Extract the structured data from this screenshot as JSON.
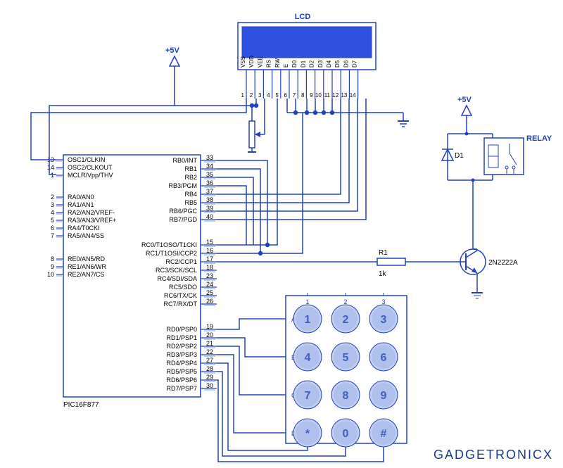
{
  "title": "LCD",
  "power_label": "+5V",
  "relay_label": "RELAY",
  "diode": "D1",
  "resistor": {
    "name": "R1",
    "value": "1k"
  },
  "transistor": "2N2222A",
  "mcu_name": "PIC16F877",
  "brand": "GADGETRONICX",
  "mcu_pins_left": [
    {
      "num": "13",
      "name": "OSC1/CLKIN"
    },
    {
      "num": "14",
      "name": "OSC2/CLKOUT"
    },
    {
      "num": "1",
      "name": "MCLR/Vpp/THV"
    },
    {
      "num": "2",
      "name": "RA0/AN0"
    },
    {
      "num": "3",
      "name": "RA1/AN1"
    },
    {
      "num": "4",
      "name": "RA2/AN2/VREF-"
    },
    {
      "num": "5",
      "name": "RA3/AN3/VREF+"
    },
    {
      "num": "6",
      "name": "RA4/T0CKI"
    },
    {
      "num": "7",
      "name": "RA5/AN4/SS"
    },
    {
      "num": "8",
      "name": "RE0/AN5/RD"
    },
    {
      "num": "9",
      "name": "RE1/AN6/WR"
    },
    {
      "num": "10",
      "name": "RE2/AN7/CS"
    }
  ],
  "mcu_pins_right_top": [
    {
      "num": "33",
      "name": "RB0/INT"
    },
    {
      "num": "34",
      "name": "RB1"
    },
    {
      "num": "35",
      "name": "RB2"
    },
    {
      "num": "36",
      "name": "RB3/PGM"
    },
    {
      "num": "37",
      "name": "RB4"
    },
    {
      "num": "38",
      "name": "RB5"
    },
    {
      "num": "39",
      "name": "RB6/PGC"
    },
    {
      "num": "40",
      "name": "RB7/PGD"
    }
  ],
  "mcu_pins_right_mid": [
    {
      "num": "15",
      "name": "RC0/T1OSO/T1CKI"
    },
    {
      "num": "16",
      "name": "RC1/T1OSI/CCP2"
    },
    {
      "num": "17",
      "name": "RC2/CCP1"
    },
    {
      "num": "18",
      "name": "RC3/SCK/SCL"
    },
    {
      "num": "23",
      "name": "RC4/SDI/SDA"
    },
    {
      "num": "24",
      "name": "RC5/SDO"
    },
    {
      "num": "25",
      "name": "RC6/TX/CK"
    },
    {
      "num": "26",
      "name": "RC7/RX/DT"
    }
  ],
  "mcu_pins_right_bot": [
    {
      "num": "19",
      "name": "RD0/PSP0"
    },
    {
      "num": "20",
      "name": "RD1/PSP1"
    },
    {
      "num": "21",
      "name": "RD2/PSP2"
    },
    {
      "num": "22",
      "name": "RD3/PSP3"
    },
    {
      "num": "27",
      "name": "RD4/PSP4"
    },
    {
      "num": "28",
      "name": "RD5/PSP5"
    },
    {
      "num": "29",
      "name": "RD6/PSP6"
    },
    {
      "num": "30",
      "name": "RD7/PSP7"
    }
  ],
  "lcd_pins": [
    "VSS",
    "VDD",
    "VEE",
    "RS",
    "RW",
    "E",
    "D0",
    "D1",
    "D2",
    "D3",
    "D4",
    "D5",
    "D6",
    "D7"
  ],
  "lcd_nums": [
    "1",
    "2",
    "3",
    "4",
    "5",
    "6",
    "7",
    "8",
    "9",
    "10",
    "11",
    "12",
    "13",
    "14"
  ],
  "keypad_cols": [
    "1",
    "2",
    "3"
  ],
  "keypad_rows": [
    "A",
    "B",
    "C",
    "D"
  ],
  "keypad_keys": [
    [
      "1",
      "2",
      "3"
    ],
    [
      "4",
      "5",
      "6"
    ],
    [
      "7",
      "8",
      "9"
    ],
    [
      "*",
      "0",
      "#"
    ]
  ]
}
